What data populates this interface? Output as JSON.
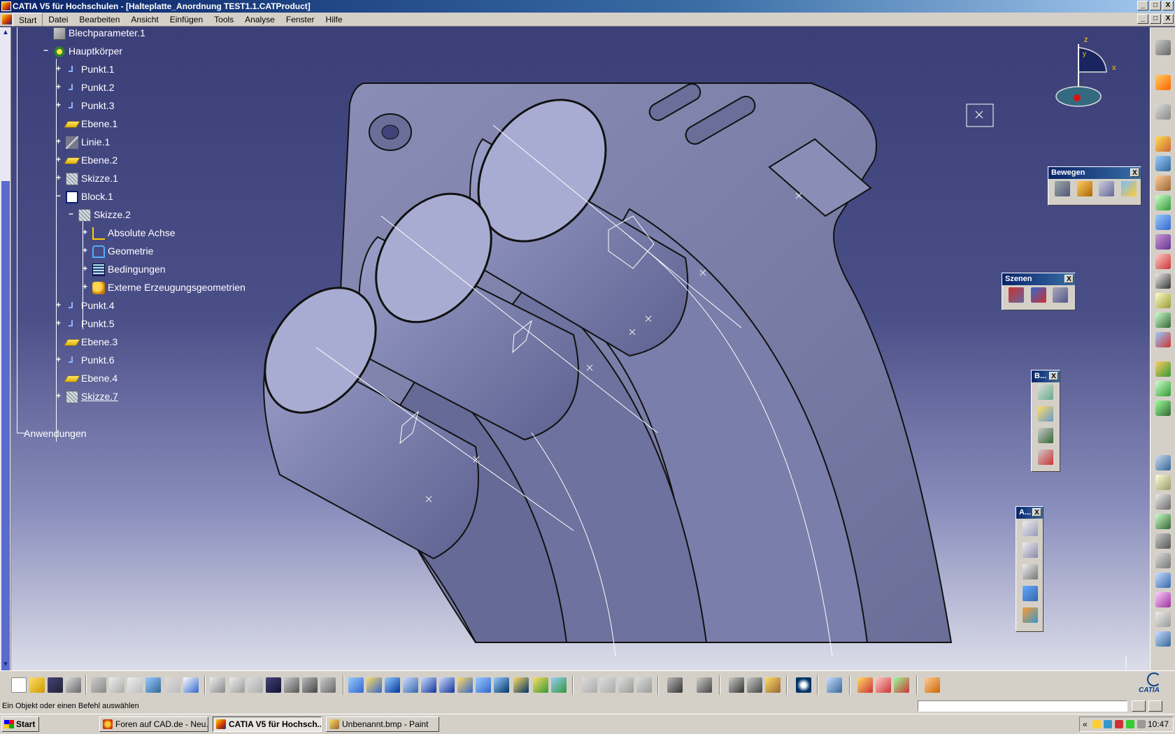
{
  "window": {
    "title": "CATIA V5 für Hochschulen - [Halteplatte_Anordnung TEST1.1.CATProduct]",
    "buttons": {
      "minimize": "_",
      "maximize": "□",
      "close": "X"
    }
  },
  "menubar": {
    "items": [
      "Start",
      "Datei",
      "Bearbeiten",
      "Ansicht",
      "Einfügen",
      "Tools",
      "Analyse",
      "Fenster",
      "Hilfe"
    ]
  },
  "tree": {
    "nodes": [
      {
        "label": "Blechparameter.1",
        "icon": "sheetmetal-params-icon"
      },
      {
        "label": "Hauptkörper",
        "icon": "partbody-gear-icon"
      },
      {
        "label": "Punkt.1",
        "icon": "point-icon"
      },
      {
        "label": "Punkt.2",
        "icon": "point-icon"
      },
      {
        "label": "Punkt.3",
        "icon": "point-icon"
      },
      {
        "label": "Ebene.1",
        "icon": "plane-icon"
      },
      {
        "label": "Linie.1",
        "icon": "line-icon"
      },
      {
        "label": "Ebene.2",
        "icon": "plane-icon"
      },
      {
        "label": "Skizze.1",
        "icon": "sketch-icon"
      },
      {
        "label": "Block.1",
        "icon": "pad-icon"
      },
      {
        "label": "Skizze.2",
        "icon": "sketch-icon"
      },
      {
        "label": "Absolute Achse",
        "icon": "axis-icon"
      },
      {
        "label": "Geometrie",
        "icon": "geometry-icon"
      },
      {
        "label": "Bedingungen",
        "icon": "constraints-icon"
      },
      {
        "label": "Externe Erzeugungsgeometrien",
        "icon": "external-geometry-icon"
      },
      {
        "label": "Punkt.4",
        "icon": "point-icon"
      },
      {
        "label": "Punkt.5",
        "icon": "point-icon"
      },
      {
        "label": "Ebene.3",
        "icon": "plane-icon"
      },
      {
        "label": "Punkt.6",
        "icon": "point-icon"
      },
      {
        "label": "Ebene.4",
        "icon": "plane-icon"
      },
      {
        "label": "Skizze.7",
        "icon": "sketch-icon"
      },
      {
        "label": "Anwendungen",
        "icon": ""
      }
    ]
  },
  "compass": {
    "z": "z",
    "x": "x",
    "y": "y"
  },
  "floating_toolbars": {
    "bewegen": {
      "title": "Bewegen",
      "close": "X"
    },
    "szenen": {
      "title": "Szenen",
      "close": "X"
    },
    "b": {
      "title": "B...",
      "close": "X"
    },
    "a": {
      "title": "A...",
      "close": "X"
    }
  },
  "statusbar": {
    "message": "Ein Objekt oder einen Befehl auswählen",
    "command_placeholder": ""
  },
  "taskbar": {
    "start": "Start",
    "tasks": [
      {
        "label": "Foren auf CAD.de - Neu...",
        "icon": "firefox-icon"
      },
      {
        "label": "CATIA V5 für Hochsch...",
        "icon": "catia-icon",
        "active": true
      },
      {
        "label": "Unbenannt.bmp - Paint",
        "icon": "paint-icon"
      }
    ],
    "clock": "10:47",
    "tray_expand": "«"
  },
  "branding": {
    "logo_text": "CATIA"
  },
  "colors": {
    "viewport_top": "#3b3f78",
    "viewport_bottom": "#dcdde9",
    "tree_text": "#ffffff",
    "title_bar": "#0a246a",
    "model_fill": "#7a7fa8"
  }
}
